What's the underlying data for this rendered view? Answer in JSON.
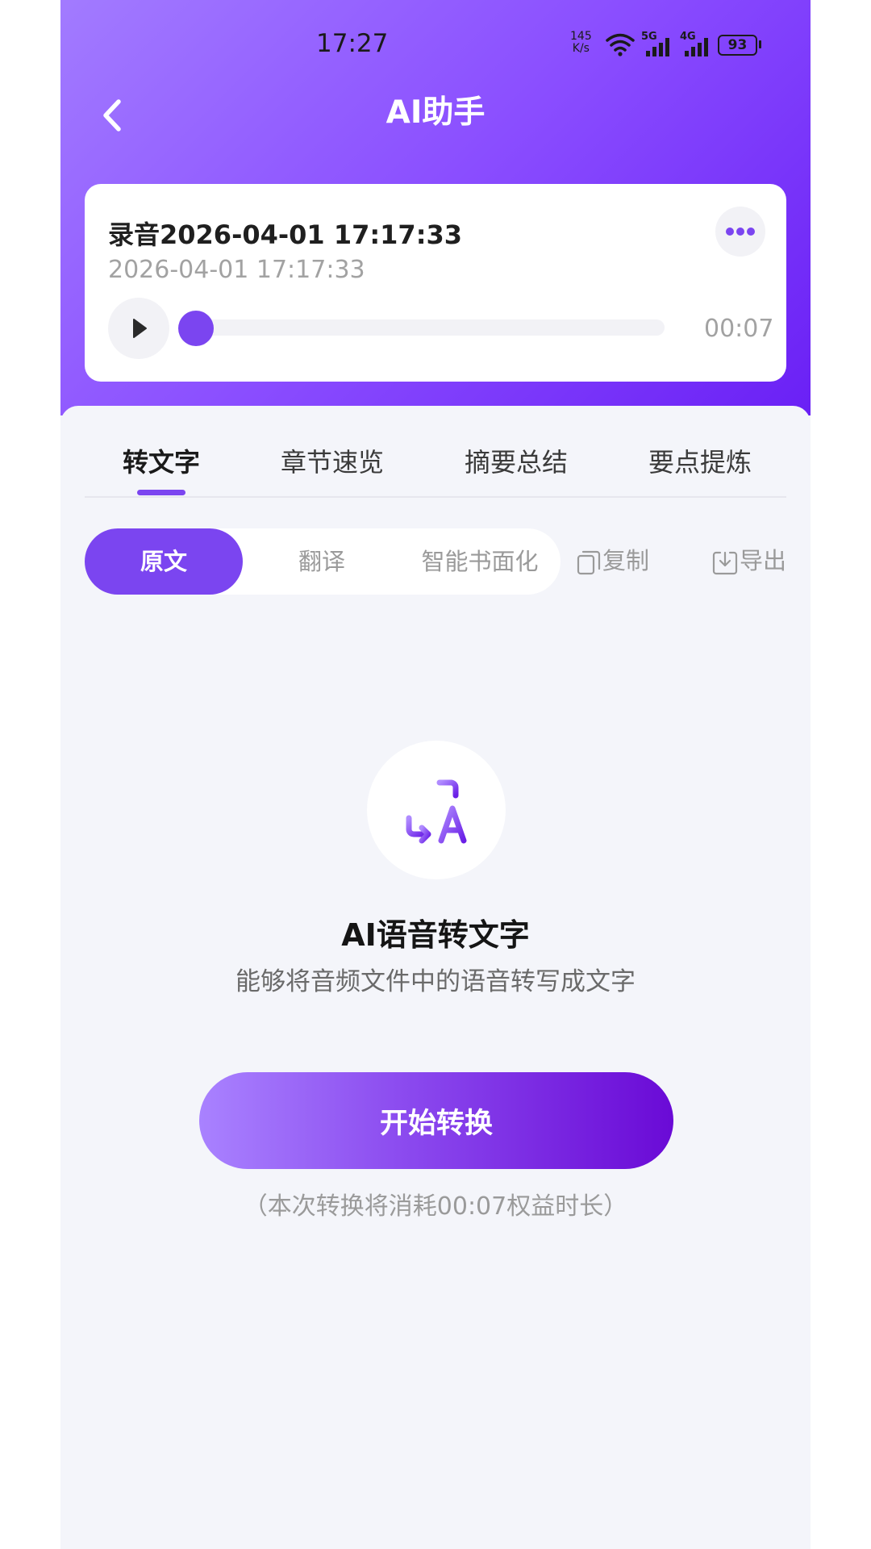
{
  "status_bar": {
    "time": "17:27",
    "speed_value": "145",
    "speed_unit": "K/s",
    "signal_1": "5G",
    "signal_2": "4G",
    "battery": "93"
  },
  "header": {
    "title": "AI助手"
  },
  "recording": {
    "title": "录音2026-04-01 17:17:33",
    "date": "2026-04-01 17:17:33",
    "duration": "00:07",
    "progress": 0
  },
  "tabs": [
    {
      "label": "转文字",
      "active": true
    },
    {
      "label": "章节速览",
      "active": false
    },
    {
      "label": "摘要总结",
      "active": false
    },
    {
      "label": "要点提炼",
      "active": false
    }
  ],
  "segments": [
    {
      "label": "原文",
      "active": true
    },
    {
      "label": "翻译",
      "active": false
    },
    {
      "label": "智能书面化",
      "active": false
    }
  ],
  "actions": {
    "copy_label": "复制",
    "export_label": "导出"
  },
  "feature": {
    "icon": "speech-to-text-icon",
    "title": "AI语音转文字",
    "description": "能够将音频文件中的语音转写成文字",
    "button_label": "开始转换",
    "note": "（本次转换将消耗00:07权益时长）"
  },
  "colors": {
    "accent": "#7b45f0",
    "header_gradient_start": "#a27bff",
    "header_gradient_end": "#6a20f5",
    "page_background": "#f4f5fa"
  }
}
